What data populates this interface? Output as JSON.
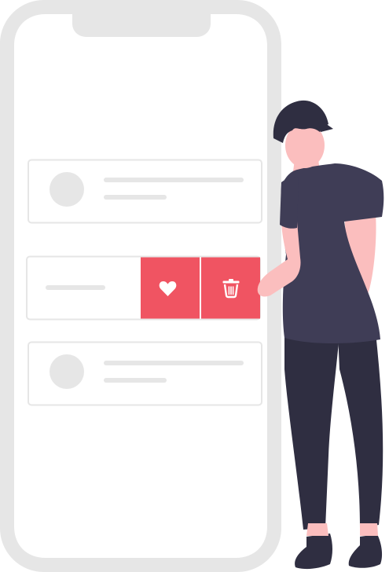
{
  "illustration": {
    "theme": "swipe-to-reveal list actions on a phone",
    "colors": {
      "phone_frame": "#e6e6e6",
      "phone_screen": "#ffffff",
      "card_border": "#e6e6e6",
      "placeholder": "#e6e6e6",
      "action_accent": "#f05462",
      "action_icon": "#ffffff",
      "skin": "#fbbebe",
      "hair": "#2f2e41",
      "shirt": "#3f3d56",
      "pants": "#2f2e41",
      "shoes": "#2f2e41"
    },
    "list_cards": [
      {
        "kind": "avatar-with-two-lines"
      },
      {
        "kind": "swiped-with-actions",
        "actions": [
          "heart-icon",
          "trash-icon"
        ]
      },
      {
        "kind": "avatar-with-two-lines"
      }
    ]
  }
}
